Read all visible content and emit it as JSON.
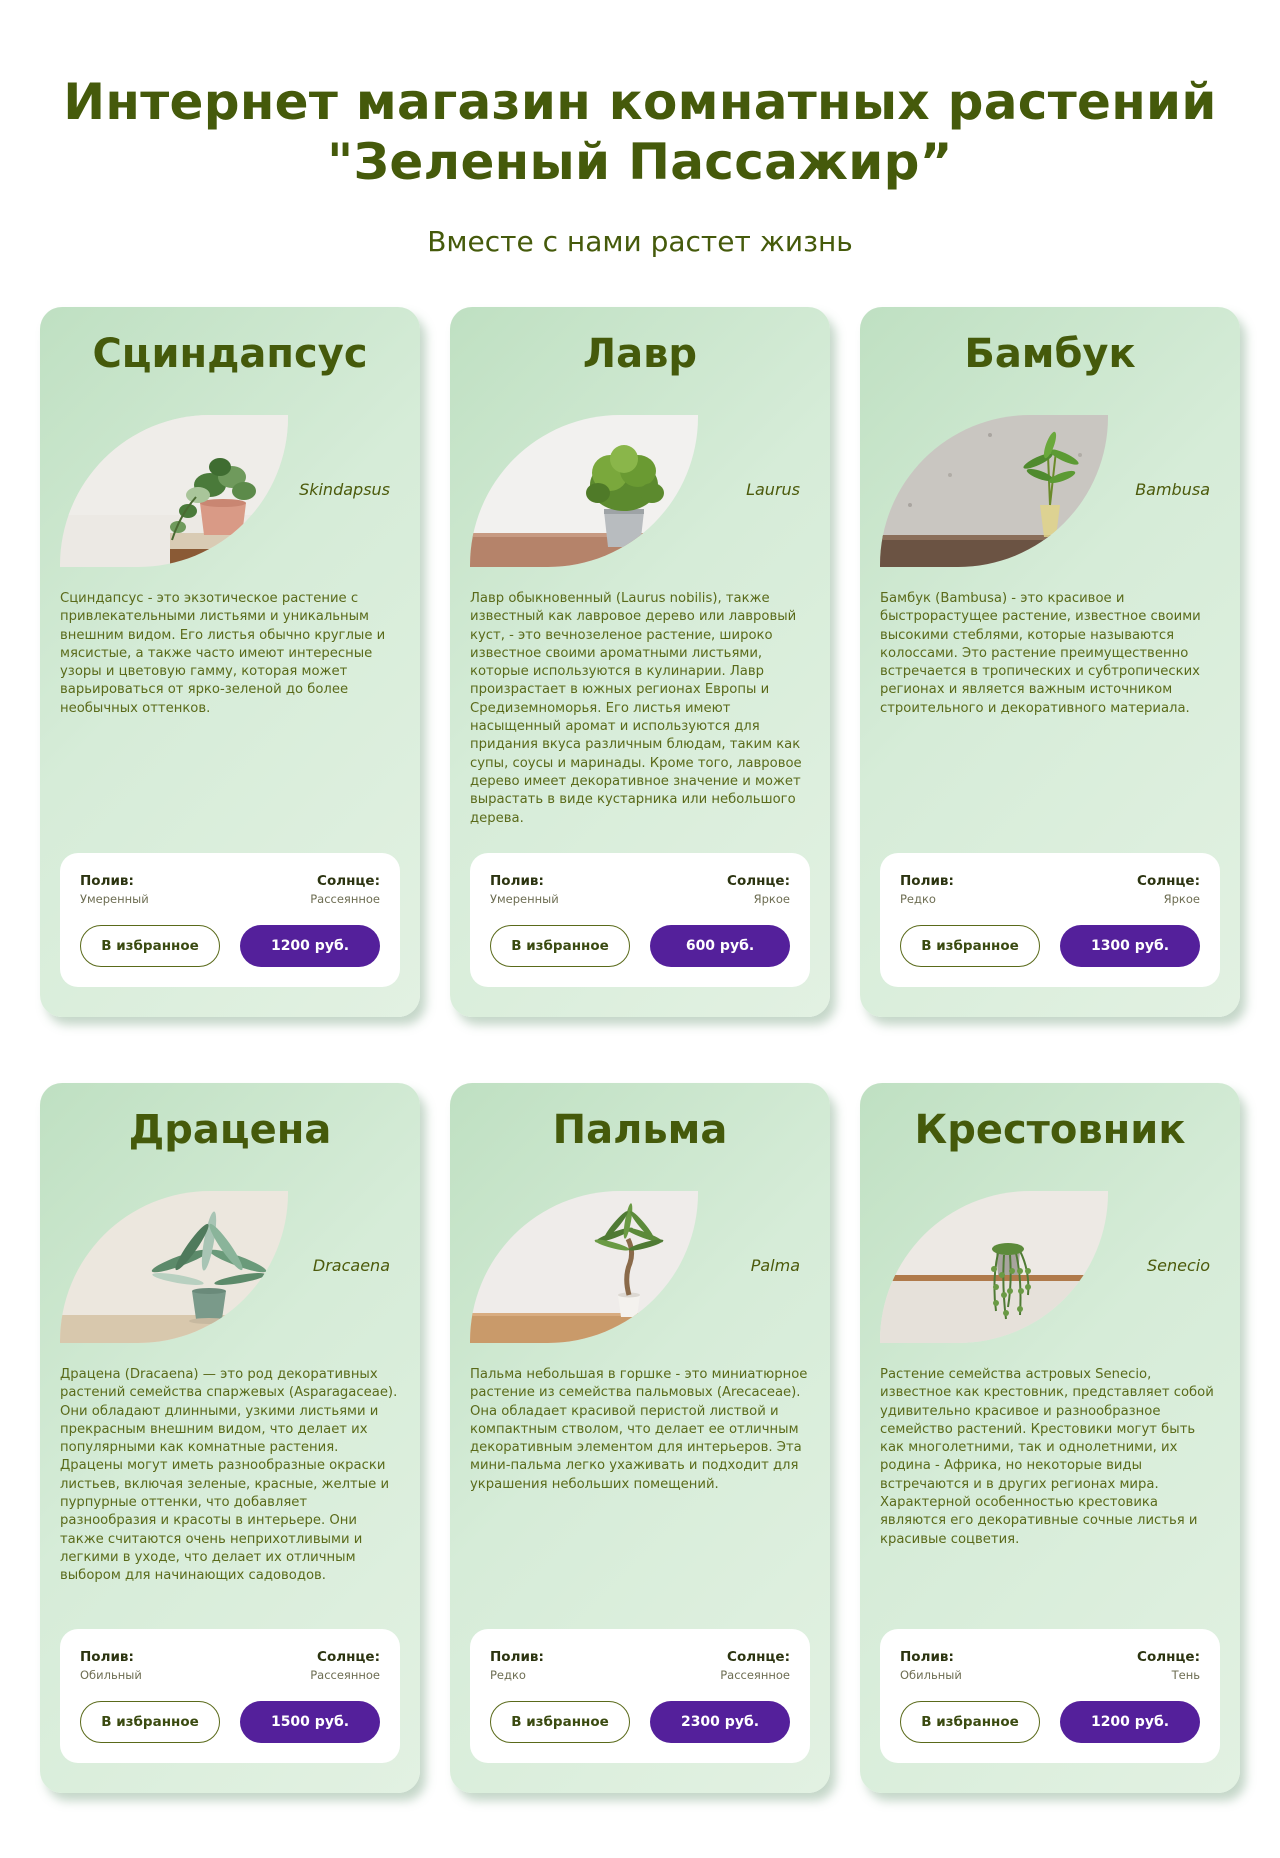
{
  "header": {
    "title_line1": "Интернет магазин комнатных растений",
    "title_line2": "\"Зеленый Пассажир”",
    "subtitle": "Вместе с нами растет жизнь"
  },
  "labels": {
    "watering": "Полив:",
    "sun": "Солнце:",
    "favorite_button": "В избранное"
  },
  "colors": {
    "accent_purple": "#54209b",
    "title_green": "#455a0b",
    "card_bg": "#cfe8d1"
  },
  "cards": [
    {
      "name": "Сциндапсус",
      "latin": "Skindapsus",
      "image_icon": "pothos-in-pink-pot",
      "description": "Сциндапсус - это экзотическое растение с привлекательными листьями и уникальным внешним видом. Его листья обычно круглые и мясистые, а также часто имеют интересные узоры и цветовую гамму, которая может варьироваться от ярко-зеленой до более необычных оттенков.",
      "watering": "Умеренный",
      "sun": "Рассеянное",
      "price": "1200 руб."
    },
    {
      "name": "Лавр",
      "latin": "Laurus",
      "image_icon": "laurel-in-metal-bucket",
      "description": "Лавр обыкновенный (Laurus nobilis), также известный как лавровое дерево или лавровый куст, - это вечнозеленое растение, широко известное своими ароматными листьями, которые используются в кулинарии. Лавр произрастает в южных регионах Европы и Средиземноморья. Его листья имеют насыщенный аромат и используются для придания вкуса различным блюдам, таким как супы, соусы и маринады. Кроме того, лавровое дерево имеет декоративное значение и может вырастать в виде кустарника или небольшого дерева.",
      "watering": "Умеренный",
      "sun": "Яркое",
      "price": "600 руб."
    },
    {
      "name": "Бамбук",
      "latin": "Bambusa",
      "image_icon": "bamboo-in-glass-vase",
      "description": "Бамбук (Bambusa) - это красивое и быстрорастущее растение, известное своими высокими стеблями, которые называются колоссами. Это растение преимущественно встречается в тропических и субтропических регионах и является важным источником строительного и декоративного материала.",
      "watering": "Редко",
      "sun": "Яркое",
      "price": "1300 руб."
    },
    {
      "name": "Драцена",
      "latin": "Dracaena",
      "image_icon": "dracaena-in-green-pot",
      "description": "Драцена (Dracaena) — это род декоративных растений семейства спаржевых (Asparagaceae). Они обладают длинными, узкими листьями и прекрасным внешним видом, что делает их популярными как комнатные растения. Драцены могут иметь разнообразные окраски листьев, включая зеленые, красные, желтые и пурпурные оттенки, что добавляет разнообразия и красоты в интерьере. Они также считаются очень неприхотливыми и легкими в уходе, что делает их отличным выбором для начинающих садоводов.",
      "watering": "Обильный",
      "sun": "Рассеянное",
      "price": "1500 руб."
    },
    {
      "name": "Пальма",
      "latin": "Palma",
      "image_icon": "small-palm-in-white-pot",
      "description": "Пальма небольшая в горшке - это миниатюрное растение из семейства пальмовых (Arecaceae). Она обладает красивой перистой листвой и компактным стволом, что делает ее отличным декоративным элементом для интерьеров. Эта мини-пальма легко ухаживать и подходит для украшения небольших помещений.",
      "watering": "Редко",
      "sun": "Рассеянное",
      "price": "2300 руб."
    },
    {
      "name": "Крестовник",
      "latin": "Senecio",
      "image_icon": "hanging-senecio-on-shelf",
      "description": "Растение семейства астровых Senecio, известное как крестовник, представляет собой удивительно красивое и разнообразное семейство растений. Крестовики могут быть как многолетними, так и однолетними, их родина - Африка, но некоторые виды встречаются и в других регионах мира. Характерной особенностью крестовика являются его декоративные сочные листья и красивые соцветия.",
      "watering": "Обильный",
      "sun": "Тень",
      "price": "1200 руб."
    }
  ]
}
